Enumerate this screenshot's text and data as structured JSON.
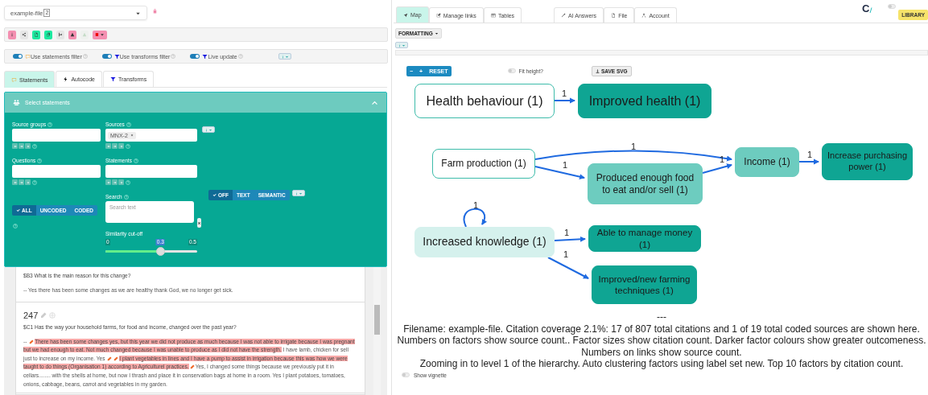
{
  "file_select": {
    "value": "example-file",
    "badge": "2"
  },
  "toolbar": [
    {
      "kind": "info",
      "color": "#f48fb1",
      "disabled": false
    },
    {
      "kind": "share",
      "color": "#e6e6e6",
      "disabled": false
    },
    {
      "kind": "file",
      "color": "#1de9a0",
      "disabled": false
    },
    {
      "kind": "copy",
      "color": "#1de9a0",
      "disabled": false
    },
    {
      "kind": "branch",
      "color": "#e6e6e6",
      "disabled": false
    },
    {
      "kind": "warning",
      "color": "#f48fb1",
      "disabled": false
    },
    {
      "kind": "warning",
      "color": "#eef1ee",
      "disabled": true
    },
    {
      "kind": "palette",
      "color": "#f48fb1",
      "disabled": false
    }
  ],
  "filters": [
    {
      "label": "Use statements filter",
      "kind": "comment",
      "on": true
    },
    {
      "label": "Use transforms filter",
      "kind": "filter",
      "on": true
    },
    {
      "label": "Live update",
      "kind": "filter",
      "on": true
    }
  ],
  "left_tabs": [
    {
      "label": "Statements",
      "kind": "comment",
      "selected": true
    },
    {
      "label": "Autocode",
      "kind": "bolt",
      "selected": false
    },
    {
      "label": "Transforms",
      "kind": "filter",
      "selected": false
    }
  ],
  "panel": {
    "title": "Select statements",
    "expanded": true,
    "source_groups": {
      "label": "Source groups"
    },
    "sources": {
      "label": "Sources",
      "tags": [
        "MNX-2"
      ]
    },
    "questions": {
      "label": "Questions"
    },
    "statements": {
      "label": "Statements"
    },
    "coding_filter": [
      {
        "label": "ALL",
        "selected": true
      },
      {
        "label": "UNCODED",
        "selected": false
      },
      {
        "label": "CODED",
        "selected": false
      }
    ],
    "search": {
      "label": "Search",
      "placeholder": "Search text"
    },
    "search_mode": [
      {
        "label": "OFF",
        "selected": true
      },
      {
        "label": "TEXT",
        "selected": false
      },
      {
        "label": "SEMANTIC",
        "selected": false
      }
    ],
    "similarity": {
      "label": "Similarity cut-off",
      "min": "0",
      "value": "0.3",
      "max": "0.5",
      "level": 0.6
    }
  },
  "statements": [
    {
      "question": "$B3 What is the main reason for this change?",
      "segments": [
        {
          "kind": "text",
          "text": "-- Yes there has been some changes as we are healthy thank God, we no longer get sick.",
          "highlighted": false
        }
      ]
    },
    {
      "number": "247",
      "question": "$C1 Has the way your household farms, for food and income, changed over the past year?",
      "segments": [
        {
          "kind": "text",
          "text": "-- ",
          "highlighted": false
        },
        {
          "kind": "mark"
        },
        {
          "kind": "text",
          "text": "There has been some changes yes, but this year we did not produce as much because I was not able to irrigate because I was pregnant but we had enough to eat. Not much changed because I was unable to produce as I did not have the strength.",
          "highlighted": true
        },
        {
          "kind": "text",
          "text": " I have lamb, chicken for sell just to increase on my income. Yes ",
          "highlighted": false
        },
        {
          "kind": "mark"
        },
        {
          "kind": "mark"
        },
        {
          "kind": "text",
          "text": "I plant vegetables in lines and I have a pump to assist in irrigation because this was how we were taught to do things (Organisation 1) according to Agriculturel practices.",
          "highlighted": true
        },
        {
          "kind": "mark"
        },
        {
          "kind": "text",
          "text": "Yes, I changed some things because we previously put it in cellars........ with the shells at home, but now I thrash and place it in conservation bags at home in a room. Yes I plant potatoes, tomatoes, onions, cabbage, beans, carrot and vegetables in my garden.",
          "highlighted": false
        }
      ]
    }
  ],
  "right_tabs": [
    {
      "label": "Map",
      "kind": "map",
      "selected": true
    },
    {
      "label": "Manage links",
      "kind": "edit",
      "selected": false
    },
    {
      "label": "Tables",
      "kind": "table",
      "selected": false
    }
  ],
  "right_tabs_2": [
    {
      "label": "AI Answers",
      "kind": "wand",
      "selected": false
    },
    {
      "label": "File",
      "kind": "file",
      "selected": false
    },
    {
      "label": "Account",
      "kind": "user",
      "selected": false
    }
  ],
  "logo": "C",
  "theme_toggle": {
    "on": false
  },
  "library_button": "LIBRARY",
  "formatting_button": "FORMATTING",
  "map_controls": {
    "zoom_out": "−",
    "zoom_in": "+",
    "reset": "RESET",
    "fit_height": {
      "label": "Fit height?",
      "on": false
    },
    "save": "SAVE SVG"
  },
  "graph": {
    "nodes": [
      {
        "label": "Health behaviour (1)",
        "color": "#ffffff"
      },
      {
        "label": "Improved health (1)",
        "color": "#0fa593"
      },
      {
        "label": "Farm production (1)",
        "color": "#ffffff"
      },
      {
        "label": "Produced enough food to eat and/or sell (1)",
        "color": "#6dccbf"
      },
      {
        "label": "Income (1)",
        "color": "#6dccbf"
      },
      {
        "label": "Increase purchasing power (1)",
        "color": "#0fa593"
      },
      {
        "label": "Increased knowledge (1)",
        "color": "#d5f1ed"
      },
      {
        "label": "Able to manage money (1)",
        "color": "#0fa593"
      },
      {
        "label": "Improved/new farming techniques (1)",
        "color": "#0fa593"
      }
    ],
    "edges": [
      {
        "label": "1"
      },
      {
        "label": "1"
      },
      {
        "label": "1"
      },
      {
        "label": "1"
      },
      {
        "label": "1"
      },
      {
        "label": "1"
      },
      {
        "label": "1"
      },
      {
        "label": "1"
      }
    ]
  },
  "caption": {
    "separator": "---",
    "lines": [
      "Filename: example-file. Citation coverage 2.1%: 17 of 807 total citations and 1 of 19 total coded sources are shown here.",
      "Numbers on factors show source count.. Factor sizes show citation count. Darker factor colours show greater outcomeness.",
      "Numbers on links show source count.",
      "Zooming in to level 1 of the hierarchy. Auto clustering factors using label set new. Top 10 factors by citation count."
    ]
  },
  "show_vignette": {
    "label": "Show vignette",
    "on": false
  }
}
